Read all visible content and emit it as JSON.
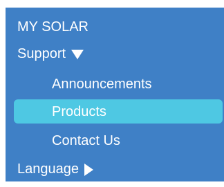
{
  "menu": {
    "title": "MY SOLAR",
    "support": {
      "label": "Support",
      "expanded": true,
      "icon": "caret-down-icon",
      "items": [
        {
          "label": "Announcements",
          "selected": false
        },
        {
          "label": "Products",
          "selected": true
        },
        {
          "label": "Contact Us",
          "selected": false
        }
      ]
    },
    "language": {
      "label": "Language",
      "expanded": false,
      "icon": "caret-right-icon"
    }
  },
  "colors": {
    "panel_bg": "#3f80c6",
    "selected_bg": "#4ec8e3",
    "text": "#ffffff"
  }
}
